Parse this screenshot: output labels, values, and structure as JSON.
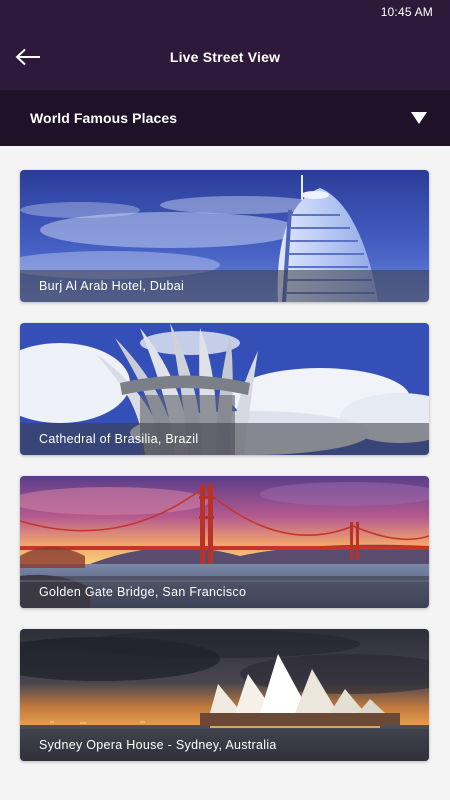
{
  "status_bar": {
    "time": "10:45 AM"
  },
  "app_bar": {
    "title": "Live Street View",
    "back_icon": "arrow-left-icon"
  },
  "category": {
    "selected": "World Famous Places",
    "icon": "dropdown-triangle-icon"
  },
  "places": [
    {
      "name": "Burj Al Arab Hotel, Dubai"
    },
    {
      "name": "Cathedral of Brasilia, Brazil"
    },
    {
      "name": "Golden Gate Bridge, San Francisco"
    },
    {
      "name": "Sydney Opera House - Sydney, Australia"
    }
  ],
  "colors": {
    "header": "#2d1a3a",
    "category_bar": "#1f1228",
    "background": "#f4f4f5"
  }
}
